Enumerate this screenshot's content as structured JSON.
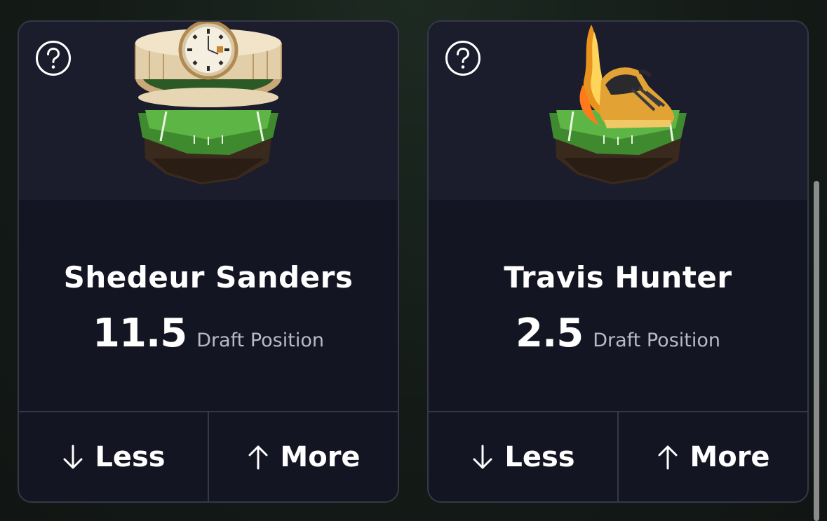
{
  "cards": [
    {
      "player_name": "Shedeur Sanders",
      "line_value": "11.5",
      "stat_label": "Draft Position",
      "art_icon": "gold-watch-on-turf-icon",
      "help_icon": "question-circle-icon",
      "less_label": "Less",
      "more_label": "More"
    },
    {
      "player_name": "Travis Hunter",
      "line_value": "2.5",
      "stat_label": "Draft Position",
      "art_icon": "flaming-gold-cleat-on-turf-icon",
      "help_icon": "question-circle-icon",
      "less_label": "Less",
      "more_label": "More"
    }
  ],
  "colors": {
    "card_bg": "#141523",
    "card_top_bg": "#1b1c2c",
    "border": "#363848",
    "stat_text": "#b9bac6"
  }
}
